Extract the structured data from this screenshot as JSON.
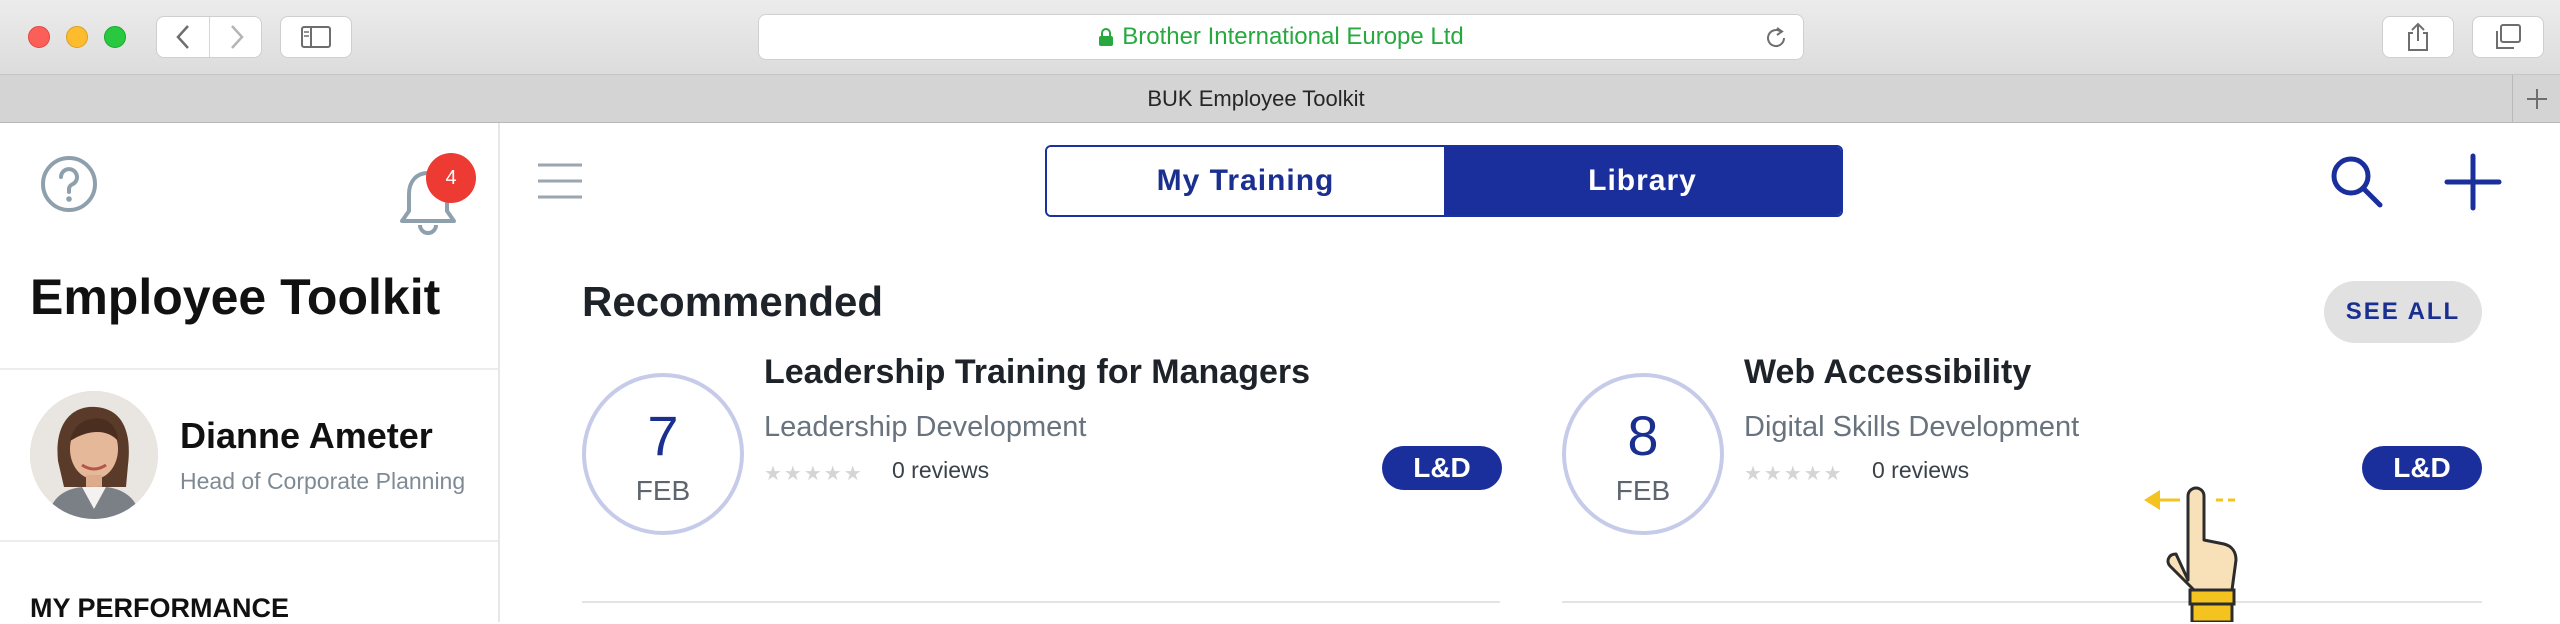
{
  "browser": {
    "url_text": "Brother International Europe Ltd",
    "tab_title": "BUK Employee Toolkit"
  },
  "sidebar": {
    "notification_count": "4",
    "app_title": "Employee Toolkit",
    "user": {
      "name": "Dianne Ameter",
      "role": "Head of Corporate Planning"
    },
    "section_title": "MY PERFORMANCE"
  },
  "header": {
    "segments": [
      {
        "label": "My Training",
        "active": false
      },
      {
        "label": "Library",
        "active": true
      }
    ]
  },
  "recommended": {
    "title": "Recommended",
    "see_all_label": "SEE ALL",
    "cards": [
      {
        "day": "7",
        "month": "FEB",
        "title": "Leadership Training for Managers",
        "category": "Leadership Development",
        "stars": "★★★★★",
        "reviews": "0 reviews",
        "tag": "L&D"
      },
      {
        "day": "8",
        "month": "FEB",
        "title": "Web Accessibility",
        "category": "Digital Skills Development",
        "stars": "★★★★★",
        "reviews": "0 reviews",
        "tag": "L&D"
      }
    ]
  },
  "colors": {
    "brand_blue": "#1a2f9c",
    "badge_red": "#ed3a32",
    "url_green": "#27a940"
  },
  "icons": [
    "help-icon",
    "bell-icon",
    "hamburger-icon",
    "search-icon",
    "add-icon",
    "swipe-hand-icon"
  ]
}
